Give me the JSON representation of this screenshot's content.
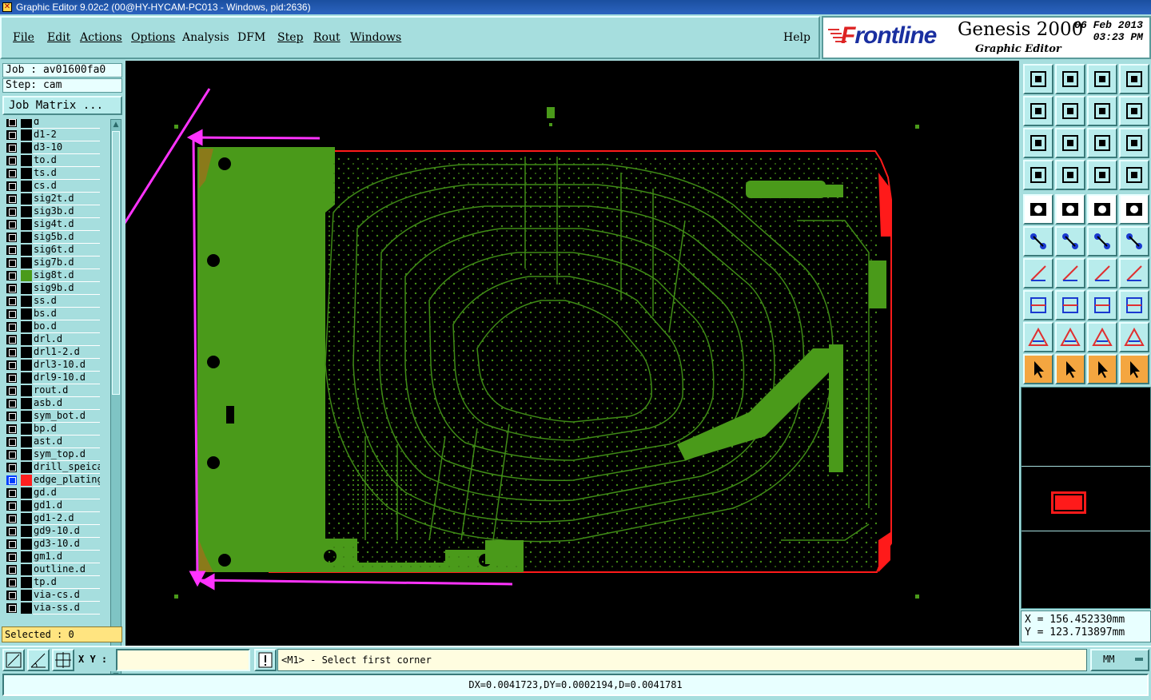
{
  "window": {
    "title": "Graphic Editor 9.02c2 (00@HY-HYCAM-PC013 - Windows, pid:2636)"
  },
  "menu": {
    "file": "File",
    "edit": "Edit",
    "actions": "Actions",
    "options": "Options",
    "analysis": "Analysis",
    "dfm": "DFM",
    "step": "Step",
    "rout": "Rout",
    "windows": "Windows",
    "help": "Help"
  },
  "logo": {
    "brand_f": "F",
    "brand_rest": "rontline",
    "product": "Genesis 2000",
    "subtitle": "Graphic Editor",
    "date": "06 Feb 2013",
    "time": "03:23 PM"
  },
  "left": {
    "job": "Job : av01600fa0",
    "step": "Step: cam",
    "job_matrix": "Job Matrix ...",
    "selected": "Selected : 0"
  },
  "layers": [
    {
      "name": "d",
      "color": "#000000"
    },
    {
      "name": "d1-2",
      "color": "#000000"
    },
    {
      "name": "d3-10",
      "color": "#000000"
    },
    {
      "name": "to.d",
      "color": "#000000"
    },
    {
      "name": "ts.d",
      "color": "#000000"
    },
    {
      "name": "cs.d",
      "color": "#000000"
    },
    {
      "name": "sig2t.d",
      "color": "#000000"
    },
    {
      "name": "sig3b.d",
      "color": "#000000"
    },
    {
      "name": "sig4t.d",
      "color": "#000000"
    },
    {
      "name": "sig5b.d",
      "color": "#000000"
    },
    {
      "name": "sig6t.d",
      "color": "#000000"
    },
    {
      "name": "sig7b.d",
      "color": "#000000"
    },
    {
      "name": "sig8t.d",
      "color": "#4a9a1a"
    },
    {
      "name": "sig9b.d",
      "color": "#000000"
    },
    {
      "name": "ss.d",
      "color": "#000000"
    },
    {
      "name": "bs.d",
      "color": "#000000"
    },
    {
      "name": "bo.d",
      "color": "#000000"
    },
    {
      "name": "drl.d",
      "color": "#000000"
    },
    {
      "name": "drl1-2.d",
      "color": "#000000"
    },
    {
      "name": "drl3-10.d",
      "color": "#000000"
    },
    {
      "name": "drl9-10.d",
      "color": "#000000"
    },
    {
      "name": "rout.d",
      "color": "#000000"
    },
    {
      "name": "asb.d",
      "color": "#000000"
    },
    {
      "name": "sym_bot.d",
      "color": "#000000"
    },
    {
      "name": "bp.d",
      "color": "#000000"
    },
    {
      "name": "ast.d",
      "color": "#000000"
    },
    {
      "name": "sym_top.d",
      "color": "#000000"
    },
    {
      "name": "drill_speical",
      "color": "#000000"
    },
    {
      "name": "edge_plating",
      "color": "#ff2020",
      "selected": true
    },
    {
      "name": "gd.d",
      "color": "#000000"
    },
    {
      "name": "gd1.d",
      "color": "#000000"
    },
    {
      "name": "gd1-2.d",
      "color": "#000000"
    },
    {
      "name": "gd9-10.d",
      "color": "#000000"
    },
    {
      "name": "gd3-10.d",
      "color": "#000000"
    },
    {
      "name": "gm1.d",
      "color": "#000000"
    },
    {
      "name": "outline.d",
      "color": "#000000"
    },
    {
      "name": "tp.d",
      "color": "#000000"
    },
    {
      "name": "via-cs.d",
      "color": "#000000"
    },
    {
      "name": "via-ss.d",
      "color": "#000000"
    }
  ],
  "coords": {
    "x": "X = 156.452330mm",
    "y": "Y = 123.713897mm"
  },
  "bottom": {
    "xy_label": "X Y :",
    "xy_value": "",
    "prompt": "<M1> - Select first corner",
    "units": "MM",
    "status": "DX=0.0041723,DY=0.0002194,D=0.0041781"
  },
  "colors": {
    "board_green": "#4a9a1a",
    "edge_red": "#ff1a1a",
    "annotation_magenta": "#ff33ff",
    "panel_cyan": "#a6dede"
  }
}
